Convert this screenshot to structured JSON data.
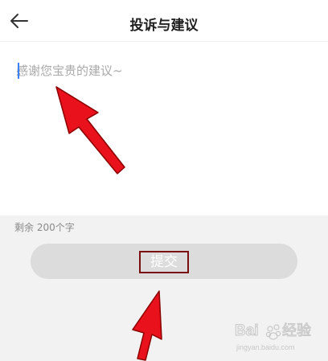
{
  "header": {
    "title": "投诉与建议",
    "back_icon": "arrow-left-icon"
  },
  "feedback": {
    "placeholder": "感谢您宝贵的建议~",
    "value": ""
  },
  "counter": {
    "text": "剩余 200个字"
  },
  "submit": {
    "label": "提交"
  },
  "watermark": {
    "text": "Baidu 经验",
    "url_text": "jingyan.baidu.com"
  },
  "colors": {
    "arrow": "#e8111c",
    "highlight_border": "#7a0f0f",
    "button_bg": "#dcdcdc",
    "bottom_bg": "#f2f2f2"
  }
}
